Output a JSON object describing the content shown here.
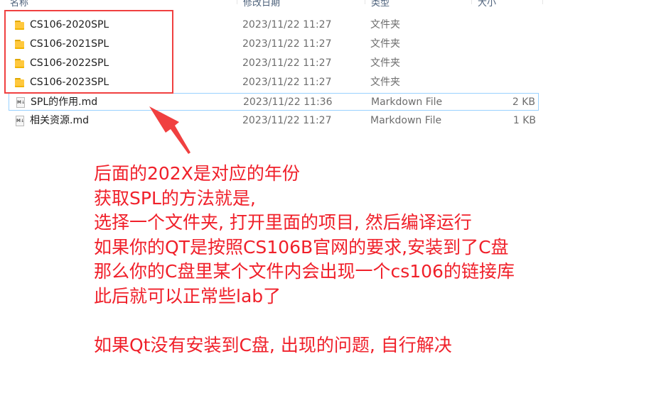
{
  "columns": {
    "name": "名称",
    "date": "修改日期",
    "type": "类型",
    "size": "大小"
  },
  "files": [
    {
      "name": "CS106-2020SPL",
      "date": "2023/11/22 11:27",
      "type": "文件夹",
      "size": "",
      "icon": "folder-icon"
    },
    {
      "name": "CS106-2021SPL",
      "date": "2023/11/22 11:27",
      "type": "文件夹",
      "size": "",
      "icon": "folder-icon"
    },
    {
      "name": "CS106-2022SPL",
      "date": "2023/11/22 11:27",
      "type": "文件夹",
      "size": "",
      "icon": "folder-icon"
    },
    {
      "name": "CS106-2023SPL",
      "date": "2023/11/22 11:27",
      "type": "文件夹",
      "size": "",
      "icon": "folder-icon"
    },
    {
      "name": "SPL的作用.md",
      "date": "2023/11/22 11:36",
      "type": "Markdown File",
      "size": "2 KB",
      "icon": "markdown-file-icon",
      "selected": true
    },
    {
      "name": "相关资源.md",
      "date": "2023/11/22 11:27",
      "type": "Markdown File",
      "size": "1 KB",
      "icon": "markdown-file-icon"
    }
  ],
  "annotation": {
    "lines": [
      "后面的202X是对应的年份",
      "获取SPL的方法就是,",
      "选择一个文件夹, 打开里面的项目, 然后编译运行",
      "如果你的QT是按照CS106B官网的要求,安装到了C盘",
      "那么你的C盘里某个文件内会出现一个cs106的链接库",
      "此后就可以正常些lab了",
      "",
      "如果Qt没有安装到C盘, 出现的问题, 自行解决"
    ],
    "color": "#f0202a",
    "box_color": "#f04040"
  }
}
